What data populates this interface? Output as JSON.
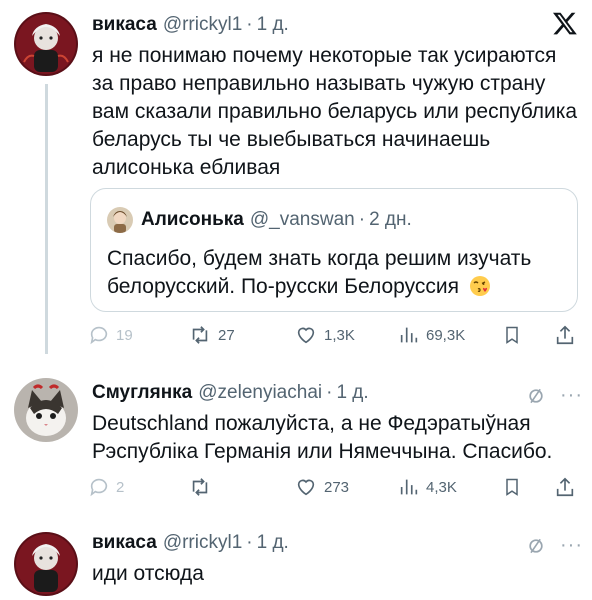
{
  "x_logo": "x-icon",
  "tweets": [
    {
      "name": "викаса",
      "handle": "@rrickyl1",
      "separator": "·",
      "time": "1 д.",
      "text": "я не понимаю почему некоторые так усираются за право неправильно называть чужую страну вам сказали правильно беларусь или республика беларусь ты че выебываться начинаешь алисонька ебливая",
      "quote": {
        "name": "Алисонька",
        "handle": "@_vanswan",
        "separator": "·",
        "time": "2 дн.",
        "text": "Спасибо, будем знать когда решим изучать белорусский. По-русски Белоруссия",
        "emoji": "face-blowing-kiss"
      },
      "actions": {
        "replies": "19",
        "retweets": "27",
        "likes": "1,3K",
        "views": "69,3K"
      }
    },
    {
      "name": "Смуглянка",
      "handle": "@zelenyiachai",
      "separator": "·",
      "time": "1 д.",
      "text": "Deutschland пожалуйста, а не Федэратыўная Рэспубліка Германія или Нямеччына. Спасибо.",
      "actions": {
        "replies": "2",
        "retweets": "",
        "likes": "273",
        "views": "4,3K"
      }
    },
    {
      "name": "викаса",
      "handle": "@rrickyl1",
      "separator": "·",
      "time": "1 д.",
      "text": "иди отсюда",
      "more": "···"
    }
  ],
  "more_label": "···"
}
